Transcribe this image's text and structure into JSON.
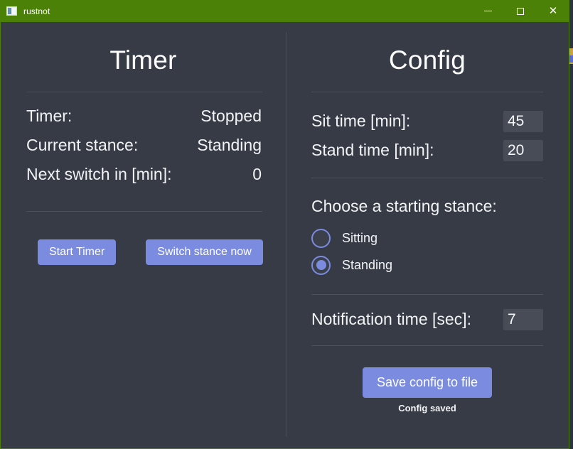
{
  "window": {
    "title": "rustnot",
    "icon": "window-pane-icon",
    "titlebar_color": "#4c8107",
    "body_color": "#363b45",
    "accent_color": "#7b8ce0",
    "controls": {
      "minimize": "minimize-icon",
      "maximize": "maximize-icon",
      "close": "close-icon"
    }
  },
  "timer_panel": {
    "heading": "Timer",
    "rows": [
      {
        "label": "Timer:",
        "value": "Stopped"
      },
      {
        "label": "Current stance:",
        "value": "Standing"
      },
      {
        "label": "Next switch in [min]:",
        "value": "0"
      }
    ],
    "buttons": {
      "start": "Start Timer",
      "switch": "Switch stance now"
    }
  },
  "config_panel": {
    "heading": "Config",
    "fields": [
      {
        "label": "Sit time [min]:",
        "value": "45"
      },
      {
        "label": "Stand time [min]:",
        "value": "20"
      }
    ],
    "stance_group": {
      "title": "Choose a starting stance:",
      "options": [
        {
          "label": "Sitting",
          "selected": false
        },
        {
          "label": "Standing",
          "selected": true
        }
      ]
    },
    "notification": {
      "label": "Notification time [sec]:",
      "value": "7"
    },
    "save_button": "Save config to file",
    "status": "Config saved"
  }
}
